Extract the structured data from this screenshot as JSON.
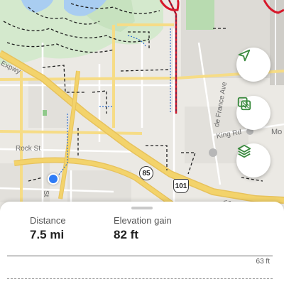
{
  "map": {
    "labels": {
      "freeway": "Expwy",
      "street_rock": "Rock St",
      "street_st": "St",
      "ave": "de France Ave",
      "king": "King Rd",
      "fa": "Fa",
      "mo": "Mo"
    },
    "shields": {
      "state_route": "85",
      "us_route": "101"
    },
    "buttons": {
      "locate_icon": "navigation-arrow",
      "overlay_icon": "map-overlay",
      "layers_icon": "layers"
    },
    "colors": {
      "route_red": "#d7182a",
      "trail_green": "#1f1f1f",
      "location_blue": "#2f7cf6",
      "highway_yellow": "#f3d36b",
      "accent_green": "#3a8a3e"
    }
  },
  "sheet": {
    "distance_label": "Distance",
    "distance_value": "7.5 mi",
    "elevation_label": "Elevation gain",
    "elevation_value": "82 ft",
    "chart_max_label": "63 ft"
  }
}
